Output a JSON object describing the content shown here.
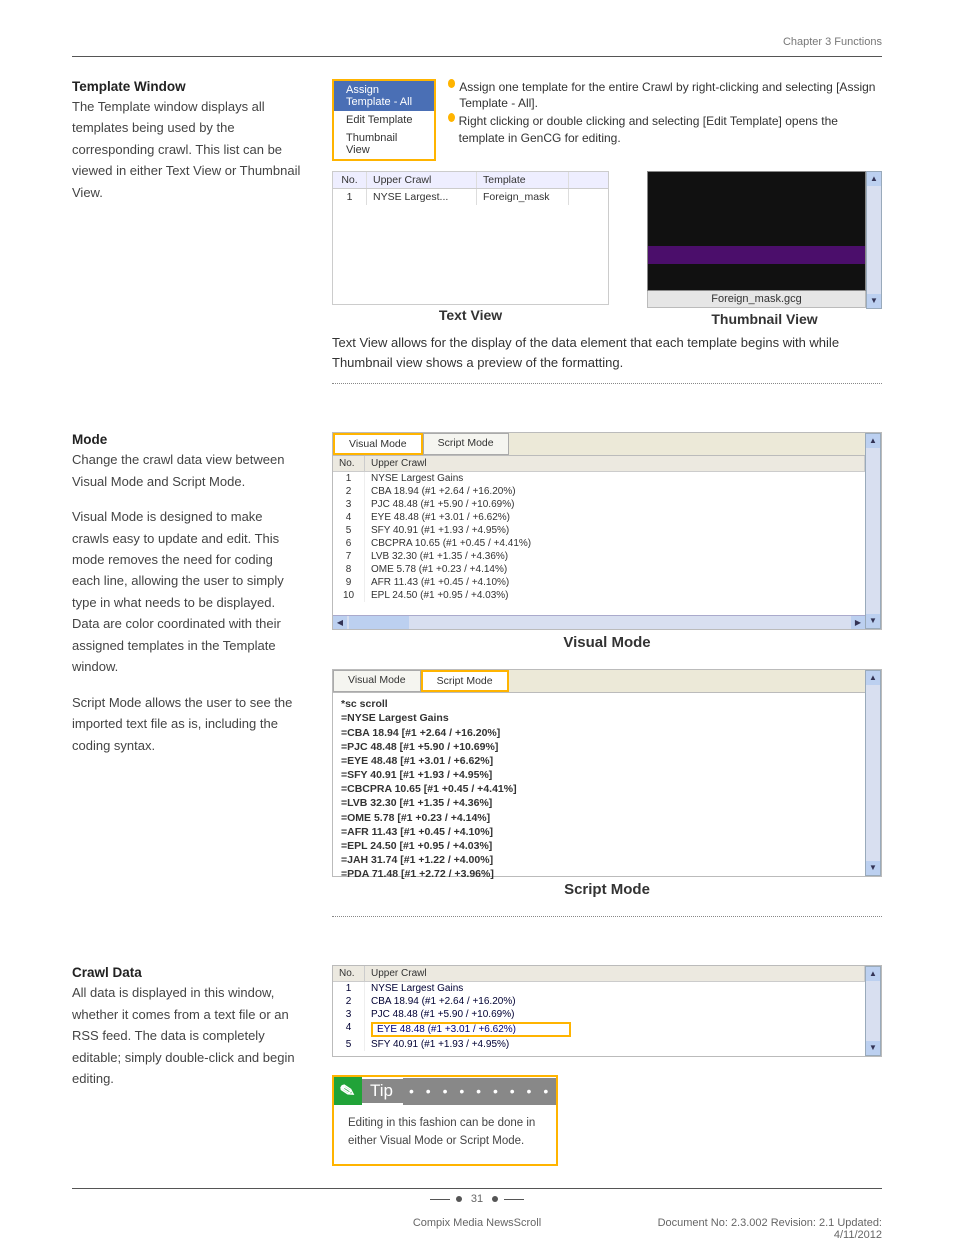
{
  "header": {
    "chapter": "Chapter 3 Functions"
  },
  "sections": {
    "template_window": {
      "title": "Template Window",
      "body": "The Template window displays all templates being used by the corresponding crawl. This list can be viewed in either Text View or Thumbnail View."
    },
    "mode": {
      "title": "Mode",
      "p1": "Change the crawl data view between Visual Mode and Script Mode.",
      "p2": "Visual Mode is designed to make crawls easy to update and edit. This mode removes the need for coding each line, allowing the user to simply type in what needs to be displayed. Data are color coordinated with their assigned templates in the Template window.",
      "p3": "Script Mode allows the user to see the imported text file as is, including the coding syntax."
    },
    "crawl_data": {
      "title": "Crawl Data",
      "body": "All data is displayed in this window, whether it comes from a text file or an RSS feed. The data is completely editable; simply double-click and begin editing."
    }
  },
  "context_menu": {
    "items": [
      "Assign Template - All",
      "Edit Template",
      "Thumbnail View"
    ],
    "annot1": "Assign one template for the entire Crawl by right-clicking and selecting [Assign Template - All].",
    "annot2": "Right clicking or double clicking and selecting [Edit Template] opens the template in GenCG for editing."
  },
  "text_view": {
    "caption": "Text View",
    "headers": {
      "no": "No.",
      "upper": "Upper Crawl",
      "template": "Template"
    },
    "rows": [
      {
        "no": "1",
        "upper": "NYSE Largest...",
        "template": "Foreign_mask"
      }
    ]
  },
  "thumbnail_view": {
    "caption": "Thumbnail View",
    "file": "Foreign_mask.gcg"
  },
  "views_para": "Text View allows for the display of the data element that each template begins with while Thumbnail view shows a preview of the formatting.",
  "tabs": {
    "visual": "Visual Mode",
    "script": "Script Mode"
  },
  "grid_header": {
    "no": "No.",
    "upper": "Upper Crawl"
  },
  "visual_mode": {
    "caption": "Visual Mode",
    "rows": [
      {
        "no": "1",
        "text": "NYSE Largest Gains"
      },
      {
        "no": "2",
        "text": "CBA 18.94 (#1 +2.64 / +16.20%)"
      },
      {
        "no": "3",
        "text": "PJC 48.48 (#1 +5.90 / +10.69%)"
      },
      {
        "no": "4",
        "text": "EYE 48.48 (#1 +3.01 / +6.62%)"
      },
      {
        "no": "5",
        "text": "SFY 40.91 (#1 +1.93 / +4.95%)"
      },
      {
        "no": "6",
        "text": "CBCPRA 10.65 (#1 +0.45 / +4.41%)"
      },
      {
        "no": "7",
        "text": "LVB 32.30 (#1 +1.35 / +4.36%)"
      },
      {
        "no": "8",
        "text": "OME 5.78 (#1 +0.23 / +4.14%)"
      },
      {
        "no": "9",
        "text": "AFR 11.43 (#1 +0.45 / +4.10%)"
      },
      {
        "no": "10",
        "text": "EPL 24.50 (#1 +0.95 / +4.03%)"
      }
    ]
  },
  "script_mode": {
    "caption": "Script Mode",
    "lines": [
      "*sc scroll",
      "=NYSE Largest Gains",
      "=CBA 18.94 [#1 +2.64 / +16.20%]",
      "=PJC 48.48 [#1 +5.90 / +10.69%]",
      "=EYE 48.48 [#1 +3.01 / +6.62%]",
      "=SFY 40.91 [#1 +1.93 / +4.95%]",
      "=CBCPRA 10.65 [#1 +0.45 / +4.41%]",
      "=LVB 32.30 [#1 +1.35 / +4.36%]",
      "=OME 5.78 [#1 +0.23 / +4.14%]",
      "=AFR 11.43 [#1 +0.45 / +4.10%]",
      "=EPL 24.50 [#1 +0.95 / +4.03%]",
      "=JAH 31.74 [#1 +1.22 / +4.00%]",
      "=PDA 71.48 [#1 +2.72 / +3.96%]"
    ]
  },
  "crawl_editor": {
    "rows": [
      {
        "no": "1",
        "text": "NYSE Largest Gains"
      },
      {
        "no": "2",
        "text": "CBA 18.94 (#1 +2.64 / +16.20%)"
      },
      {
        "no": "3",
        "text": "PJC 48.48 (#1 +5.90 / +10.69%)"
      },
      {
        "no": "4",
        "text": "EYE 48.48 (#1 +3.01 / +6.62%)",
        "editing": true
      },
      {
        "no": "5",
        "text": "SFY 40.91 (#1 +1.93 / +4.95%)"
      }
    ]
  },
  "tip": {
    "label": "Tip",
    "body": "Editing in this fashion can be done in either Visual Mode or Script Mode."
  },
  "footer": {
    "page_num": "31",
    "product": "Compix Media NewsScroll",
    "docinfo": "Document No: 2.3.002 Revision: 2.1 Updated: 4/11/2012"
  }
}
